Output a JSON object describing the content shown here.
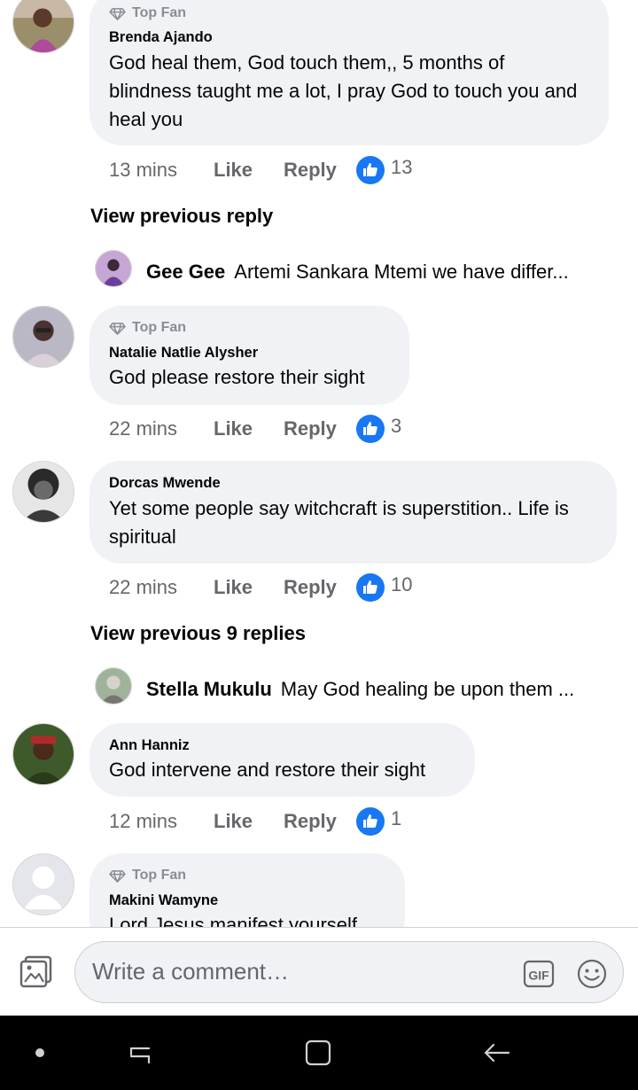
{
  "comments": [
    {
      "top_fan": "Top Fan",
      "author": "Brenda Ajando",
      "text": "God heal them, God touch them,, 5 months of blindness  taught me a lot, I pray God to touch you and heal you",
      "time": "13 mins",
      "like_label": "Like",
      "reply_label": "Reply",
      "reactions": "13"
    },
    {
      "top_fan": "Top Fan",
      "author": "Natalie Natlie Alysher",
      "text": "God please restore their sight",
      "time": "22 mins",
      "like_label": "Like",
      "reply_label": "Reply",
      "reactions": "3"
    },
    {
      "author": "Dorcas Mwende",
      "text": "Yet some people say witchcraft is superstition.. Life is spiritual",
      "time": "22 mins",
      "like_label": "Like",
      "reply_label": "Reply",
      "reactions": "10"
    },
    {
      "author": "Ann Hanniz",
      "text": "God intervene and restore their sight",
      "time": "12 mins",
      "like_label": "Like",
      "reply_label": "Reply",
      "reactions": "1"
    },
    {
      "top_fan": "Top Fan",
      "author": "Makini Wamyne",
      "text": "Lord Jesus manifest yourself"
    }
  ],
  "view_previous": [
    {
      "label": "View previous reply"
    },
    {
      "label": "View previous 9 replies"
    }
  ],
  "reply_previews": [
    {
      "author": "Gee Gee",
      "text": "Artemi Sankara Mtemi we have differ..."
    },
    {
      "author": "Stella Mukulu",
      "text": "May God healing be upon them ..."
    }
  ],
  "composer": {
    "placeholder": "Write a comment…",
    "gif_label": "GIF"
  },
  "icons": {
    "top_fan": "diamond-icon",
    "reaction": "thumbs-up-icon",
    "photo": "photo-icon",
    "emoji": "smiley-icon"
  },
  "colors": {
    "facebook_blue": "#1877f2",
    "bubble": "#f0f2f5",
    "secondary_text": "#65676b"
  }
}
